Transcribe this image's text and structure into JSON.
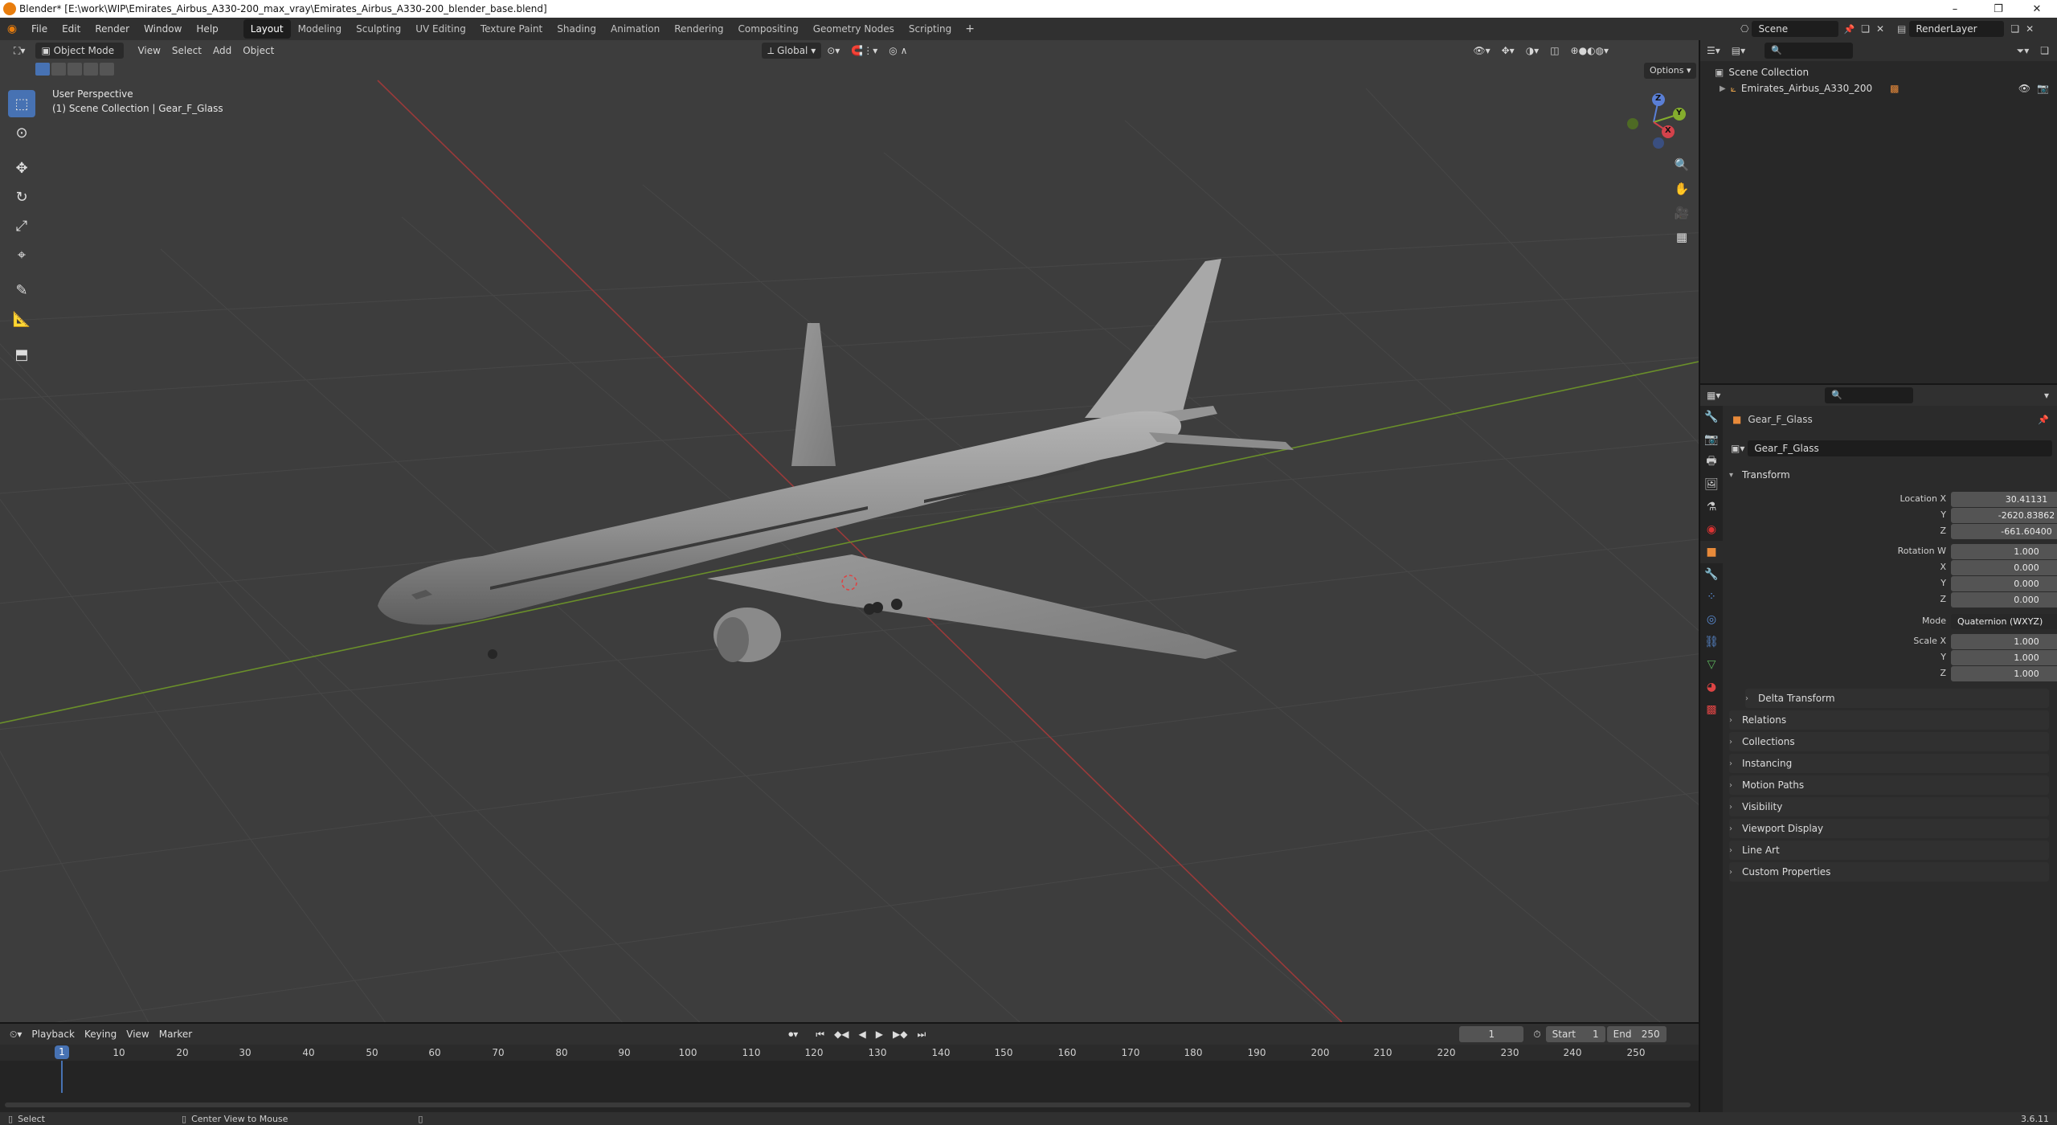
{
  "titlebar": {
    "title": "Blender* [E:\\work\\WIP\\Emirates_Airbus_A330-200_max_vray\\Emirates_Airbus_A330-200_blender_base.blend]",
    "minimize": "–",
    "restore": "❐",
    "close": "✕"
  },
  "menu": [
    "File",
    "Edit",
    "Render",
    "Window",
    "Help"
  ],
  "workspaces": [
    "Layout",
    "Modeling",
    "Sculpting",
    "UV Editing",
    "Texture Paint",
    "Shading",
    "Animation",
    "Rendering",
    "Compositing",
    "Geometry Nodes",
    "Scripting"
  ],
  "active_workspace": "Layout",
  "scene": {
    "name": "Scene",
    "view_layer": "RenderLayer"
  },
  "viewport": {
    "mode": "Object Mode",
    "menus": [
      "View",
      "Select",
      "Add",
      "Object"
    ],
    "orientation": "Global",
    "options": "Options",
    "perspective_label": "User Perspective",
    "collection_label": "(1) Scene Collection | Gear_F_Glass",
    "gizmo": {
      "x": "X",
      "y": "Y",
      "z": "Z"
    }
  },
  "outliner": {
    "root": "Scene Collection",
    "items": [
      "Emirates_Airbus_A330_200"
    ]
  },
  "properties": {
    "object_name": "Gear_F_Glass",
    "data_name": "Gear_F_Glass",
    "transform_title": "Transform",
    "location_label": "Location X",
    "location": [
      "30.41131",
      "-2620.83862",
      "-661.60400"
    ],
    "rotation_label": "Rotation W",
    "rotation": [
      "1.000",
      "0.000",
      "0.000",
      "0.000"
    ],
    "mode_label": "Mode",
    "mode_value": "Quaternion (WXYZ)",
    "scale_label": "Scale X",
    "scale": [
      "1.000",
      "1.000",
      "1.000"
    ],
    "axis": {
      "y": "Y",
      "z": "Z",
      "x": "X"
    },
    "delta": "Delta Transform",
    "panels": [
      "Relations",
      "Collections",
      "Instancing",
      "Motion Paths",
      "Visibility",
      "Viewport Display",
      "Line Art",
      "Custom Properties"
    ]
  },
  "timeline": {
    "menus": [
      "Playback",
      "Keying",
      "View",
      "Marker"
    ],
    "current_frame": "1",
    "start_label": "Start",
    "start": "1",
    "end_label": "End",
    "end": "250",
    "ticks": [
      "10",
      "20",
      "30",
      "40",
      "50",
      "60",
      "70",
      "80",
      "90",
      "100",
      "110",
      "120",
      "130",
      "140",
      "150",
      "160",
      "170",
      "180",
      "190",
      "200",
      "210",
      "220",
      "230",
      "240",
      "250"
    ]
  },
  "status": {
    "select": "Select",
    "center": "Center View to Mouse",
    "version": "3.6.11"
  }
}
